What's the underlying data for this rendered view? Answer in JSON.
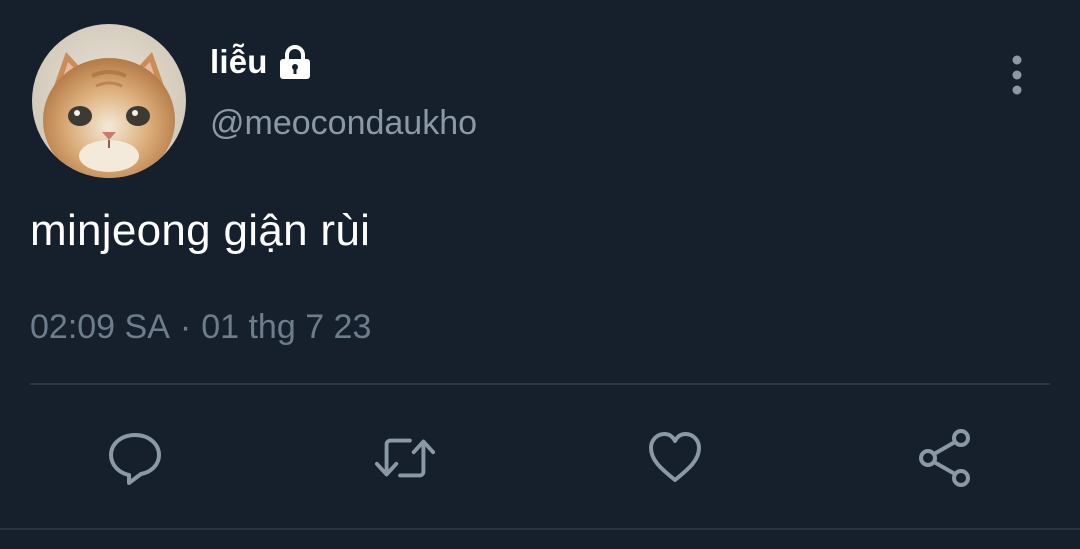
{
  "user": {
    "display_name": "liễu",
    "handle": "@meocondaukho",
    "avatar_icon": "cat-photo",
    "protected_icon": "lock-icon"
  },
  "tweet": {
    "text": "minjeong giận rùi",
    "time": "02:09 SA",
    "separator": "·",
    "date": "01 thg 7 23"
  },
  "actions": [
    {
      "name": "reply",
      "icon": "speech-bubble-icon"
    },
    {
      "name": "retweet",
      "icon": "retweet-icon"
    },
    {
      "name": "like",
      "icon": "heart-icon"
    },
    {
      "name": "share",
      "icon": "share-icon"
    }
  ],
  "menu": {
    "icon": "more-vertical-icon"
  },
  "colors": {
    "background": "#16202c",
    "primary_text": "#ffffff",
    "secondary_text": "#8b98a5",
    "icon": "#8b98a5",
    "divider": "#2a3642"
  }
}
